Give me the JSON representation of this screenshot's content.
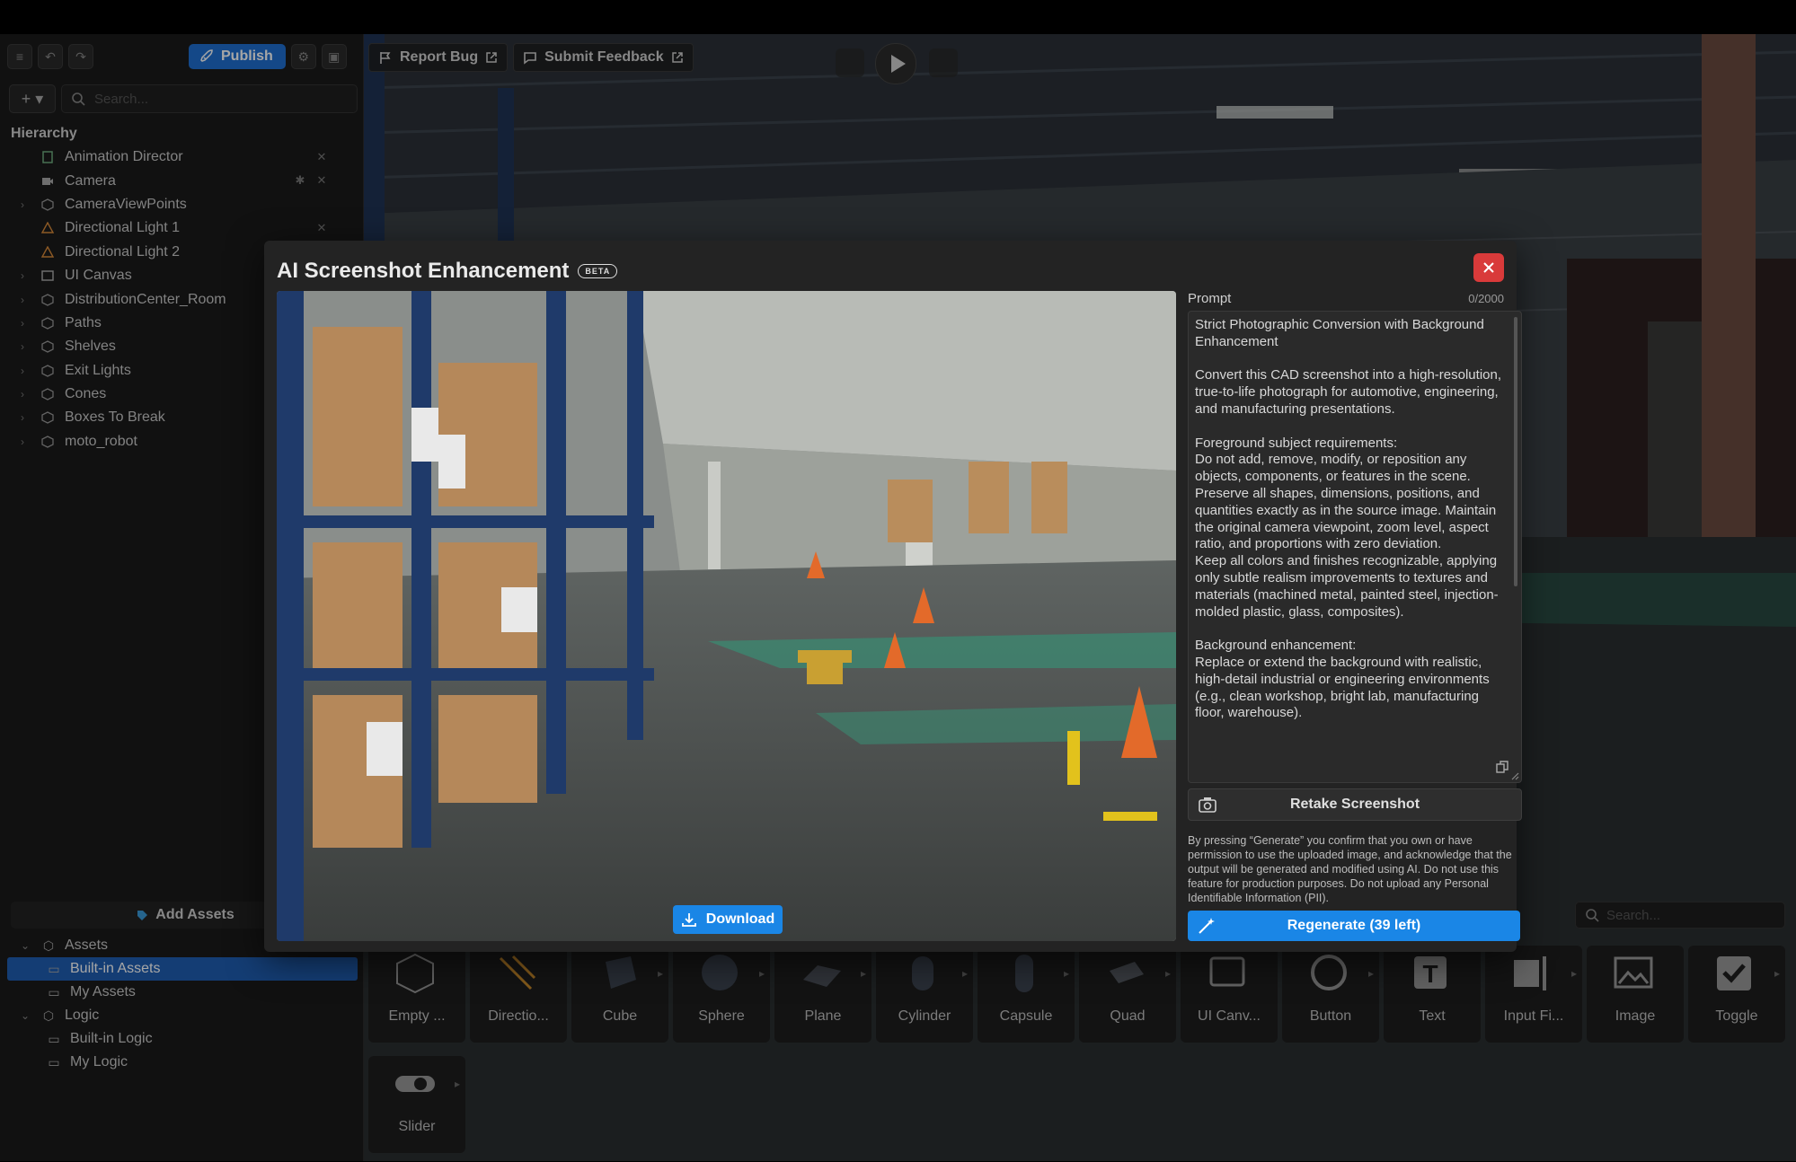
{
  "toolbar": {
    "publish_label": "Publish",
    "report_bug_label": "Report Bug",
    "submit_feedback_label": "Submit Feedback",
    "search_placeholder": "Search..."
  },
  "hierarchy": {
    "title": "Hierarchy",
    "items": [
      {
        "label": "Animation Director"
      },
      {
        "label": "Camera"
      },
      {
        "label": "CameraViewPoints"
      },
      {
        "label": "Directional Light 1"
      },
      {
        "label": "Directional Light 2"
      },
      {
        "label": "UI Canvas"
      },
      {
        "label": "DistributionCenter_Room"
      },
      {
        "label": "Paths"
      },
      {
        "label": "Shelves"
      },
      {
        "label": "Exit Lights"
      },
      {
        "label": "Cones"
      },
      {
        "label": "Boxes To Break"
      },
      {
        "label": "moto_robot"
      }
    ]
  },
  "assets_panel": {
    "add_assets_label": "Add Assets",
    "tree": [
      {
        "label": "Assets"
      },
      {
        "label": "Built-in Assets"
      },
      {
        "label": "My Assets"
      },
      {
        "label": "Logic"
      },
      {
        "label": "Built-in Logic"
      },
      {
        "label": "My Logic"
      }
    ],
    "search_placeholder": "Search...",
    "tiles": [
      {
        "label": "Empty ..."
      },
      {
        "label": "Directio..."
      },
      {
        "label": "Cube"
      },
      {
        "label": "Sphere"
      },
      {
        "label": "Plane"
      },
      {
        "label": "Cylinder"
      },
      {
        "label": "Capsule"
      },
      {
        "label": "Quad"
      },
      {
        "label": "UI Canv..."
      },
      {
        "label": "Button"
      },
      {
        "label": "Text"
      },
      {
        "label": "Input Fi..."
      },
      {
        "label": "Image"
      },
      {
        "label": "Toggle"
      },
      {
        "label": "Slider"
      }
    ]
  },
  "modal": {
    "title": "AI Screenshot Enhancement",
    "beta_badge": "BETA",
    "download_label": "Download",
    "prompt_label": "Prompt",
    "prompt_count": "0/2000",
    "prompt_text": "Strict Photographic Conversion with Background Enhancement\n\nConvert this CAD screenshot into a high-resolution, true-to-life photograph for automotive, engineering, and manufacturing presentations.\n\nForeground subject requirements:\nDo not add, remove, modify, or reposition any objects, components, or features in the scene. Preserve all shapes, dimensions, positions, and quantities exactly as in the source image. Maintain the original camera viewpoint, zoom level, aspect ratio, and proportions with zero deviation.\nKeep all colors and finishes recognizable, applying only subtle realism improvements to textures and materials (machined metal, painted steel, injection-molded plastic, glass, composites).\n\nBackground enhancement:\nReplace or extend the background with realistic, high-detail industrial or engineering environments (e.g., clean workshop, bright lab, manufacturing floor, warehouse).",
    "retake_label": "Retake Screenshot",
    "disclaimer": "By pressing “Generate” you confirm that you own or have permission to use the uploaded image, and acknowledge that the output will be generated and modified using AI. Do not use this feature for production purposes. Do not upload any Personal Identifiable Information (PII).",
    "regenerate_label": "Regenerate (39 left)"
  },
  "colors": {
    "accent": "#1a86e6",
    "close": "#d93a3a",
    "selected": "#1f5fb3"
  }
}
